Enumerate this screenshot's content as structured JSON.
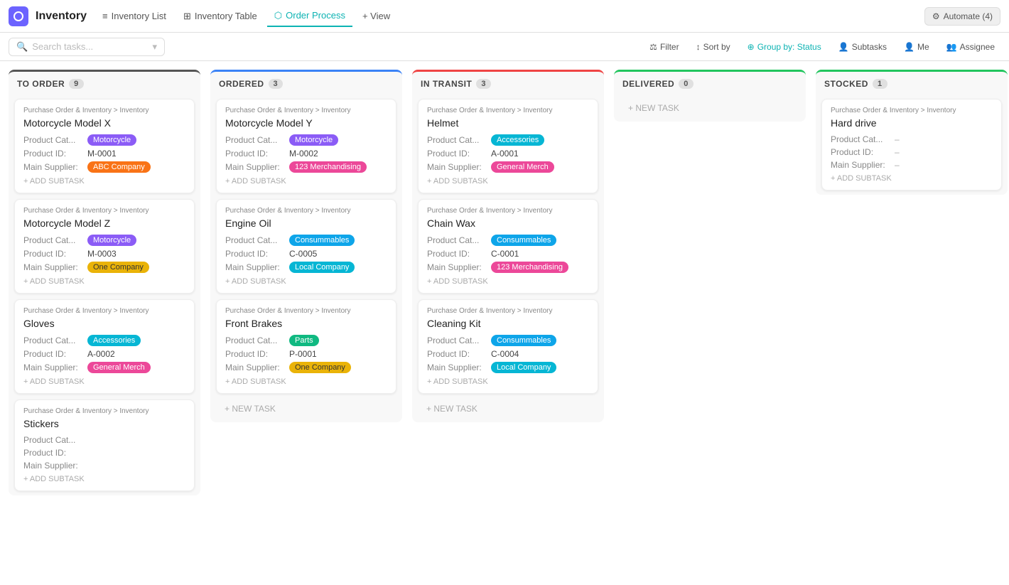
{
  "app": {
    "logo_icon": "grid-icon",
    "title": "Inventory",
    "tabs": [
      {
        "id": "inventory-list",
        "label": "Inventory List",
        "icon": "list-icon",
        "active": false
      },
      {
        "id": "inventory-table",
        "label": "Inventory Table",
        "icon": "table-icon",
        "active": false
      },
      {
        "id": "order-process",
        "label": "Order Process",
        "icon": "process-icon",
        "active": true
      },
      {
        "id": "view",
        "label": "+ View",
        "icon": "",
        "active": false
      }
    ],
    "automate_label": "Automate (4)"
  },
  "toolbar": {
    "search_placeholder": "Search tasks...",
    "filter_label": "Filter",
    "sort_label": "Sort by",
    "group_label": "Group by: Status",
    "subtasks_label": "Subtasks",
    "me_label": "Me",
    "assignee_label": "Assignee"
  },
  "board": {
    "columns": [
      {
        "id": "to-order",
        "title": "TO ORDER",
        "count": 9,
        "color_class": "to-order",
        "cards": [
          {
            "breadcrumb": "Purchase Order & Inventory > Inventory",
            "title": "Motorcycle Model X",
            "product_cat_label": "Product Cat...",
            "product_cat_badge": "Motorcycle",
            "product_cat_badge_class": "badge-motorcycle",
            "product_id_label": "Product ID:",
            "product_id": "M-0001",
            "supplier_label": "Main Supplier:",
            "supplier_badge": "ABC Company",
            "supplier_badge_class": "badge-abc"
          },
          {
            "breadcrumb": "Purchase Order & Inventory > Inventory",
            "title": "Motorcycle Model Z",
            "product_cat_label": "Product Cat...",
            "product_cat_badge": "Motorcycle",
            "product_cat_badge_class": "badge-motorcycle",
            "product_id_label": "Product ID:",
            "product_id": "M-0003",
            "supplier_label": "Main Supplier:",
            "supplier_badge": "One Company",
            "supplier_badge_class": "badge-onecompany"
          },
          {
            "breadcrumb": "Purchase Order & Inventory > Inventory",
            "title": "Gloves",
            "product_cat_label": "Product Cat...",
            "product_cat_badge": "Accessories",
            "product_cat_badge_class": "badge-accessories",
            "product_id_label": "Product ID:",
            "product_id": "A-0002",
            "supplier_label": "Main Supplier:",
            "supplier_badge": "General Merch",
            "supplier_badge_class": "badge-generalmerch"
          },
          {
            "breadcrumb": "Purchase Order & Inventory > Inventory",
            "title": "Stickers",
            "product_cat_label": "Product Cat...",
            "product_cat_badge": "",
            "product_cat_badge_class": "",
            "product_id_label": "Product ID:",
            "product_id": "",
            "supplier_label": "Main Supplier:",
            "supplier_badge": "",
            "supplier_badge_class": ""
          }
        ],
        "new_task": false
      },
      {
        "id": "ordered",
        "title": "ORDERED",
        "count": 3,
        "color_class": "ordered",
        "cards": [
          {
            "breadcrumb": "Purchase Order & Inventory > Inventory",
            "title": "Motorcycle Model Y",
            "product_cat_label": "Product Cat...",
            "product_cat_badge": "Motorcycle",
            "product_cat_badge_class": "badge-motorcycle",
            "product_id_label": "Product ID:",
            "product_id": "M-0002",
            "supplier_label": "Main Supplier:",
            "supplier_badge": "123 Merchandising",
            "supplier_badge_class": "badge-123merch"
          },
          {
            "breadcrumb": "Purchase Order & Inventory > Inventory",
            "title": "Engine Oil",
            "product_cat_label": "Product Cat...",
            "product_cat_badge": "Consummables",
            "product_cat_badge_class": "badge-consummables",
            "product_id_label": "Product ID:",
            "product_id": "C-0005",
            "supplier_label": "Main Supplier:",
            "supplier_badge": "Local Company",
            "supplier_badge_class": "badge-localcompany"
          },
          {
            "breadcrumb": "Purchase Order & Inventory > Inventory",
            "title": "Front Brakes",
            "product_cat_label": "Product Cat...",
            "product_cat_badge": "Parts",
            "product_cat_badge_class": "badge-parts",
            "product_id_label": "Product ID:",
            "product_id": "P-0001",
            "supplier_label": "Main Supplier:",
            "supplier_badge": "One Company",
            "supplier_badge_class": "badge-onecompany"
          }
        ],
        "new_task": true,
        "new_task_label": "+ NEW TASK"
      },
      {
        "id": "in-transit",
        "title": "IN TRANSIT",
        "count": 3,
        "color_class": "in-transit",
        "cards": [
          {
            "breadcrumb": "Purchase Order & Inventory > Inventory",
            "title": "Helmet",
            "product_cat_label": "Product Cat...",
            "product_cat_badge": "Accessories",
            "product_cat_badge_class": "badge-accessories",
            "product_id_label": "Product ID:",
            "product_id": "A-0001",
            "supplier_label": "Main Supplier:",
            "supplier_badge": "General Merch",
            "supplier_badge_class": "badge-generalmerch"
          },
          {
            "breadcrumb": "Purchase Order & Inventory > Inventory",
            "title": "Chain Wax",
            "product_cat_label": "Product Cat...",
            "product_cat_badge": "Consummables",
            "product_cat_badge_class": "badge-consummables",
            "product_id_label": "Product ID:",
            "product_id": "C-0001",
            "supplier_label": "Main Supplier:",
            "supplier_badge": "123 Merchandising",
            "supplier_badge_class": "badge-123merch"
          },
          {
            "breadcrumb": "Purchase Order & Inventory > Inventory",
            "title": "Cleaning Kit",
            "product_cat_label": "Product Cat...",
            "product_cat_badge": "Consummables",
            "product_cat_badge_class": "badge-consummables",
            "product_id_label": "Product ID:",
            "product_id": "C-0004",
            "supplier_label": "Main Supplier:",
            "supplier_badge": "Local Company",
            "supplier_badge_class": "badge-localcompany"
          }
        ],
        "new_task": true,
        "new_task_label": "+ NEW TASK"
      },
      {
        "id": "delivered",
        "title": "DELIVERED",
        "count": 0,
        "color_class": "delivered",
        "cards": [],
        "new_task": true,
        "new_task_label": "+ NEW TASK"
      },
      {
        "id": "stocked",
        "title": "STOCKED",
        "count": 1,
        "color_class": "stocked",
        "cards": [
          {
            "breadcrumb": "Purchase Order & Inventory > Inventory",
            "title": "Hard drive",
            "product_cat_label": "Product Cat...",
            "product_cat_badge": "",
            "product_cat_badge_class": "",
            "product_cat_dash": "–",
            "product_id_label": "Product ID:",
            "product_id": "",
            "product_id_dash": "–",
            "supplier_label": "Main Supplier:",
            "supplier_badge": "",
            "supplier_badge_class": "",
            "supplier_dash": "–"
          }
        ],
        "new_task": false
      }
    ]
  }
}
